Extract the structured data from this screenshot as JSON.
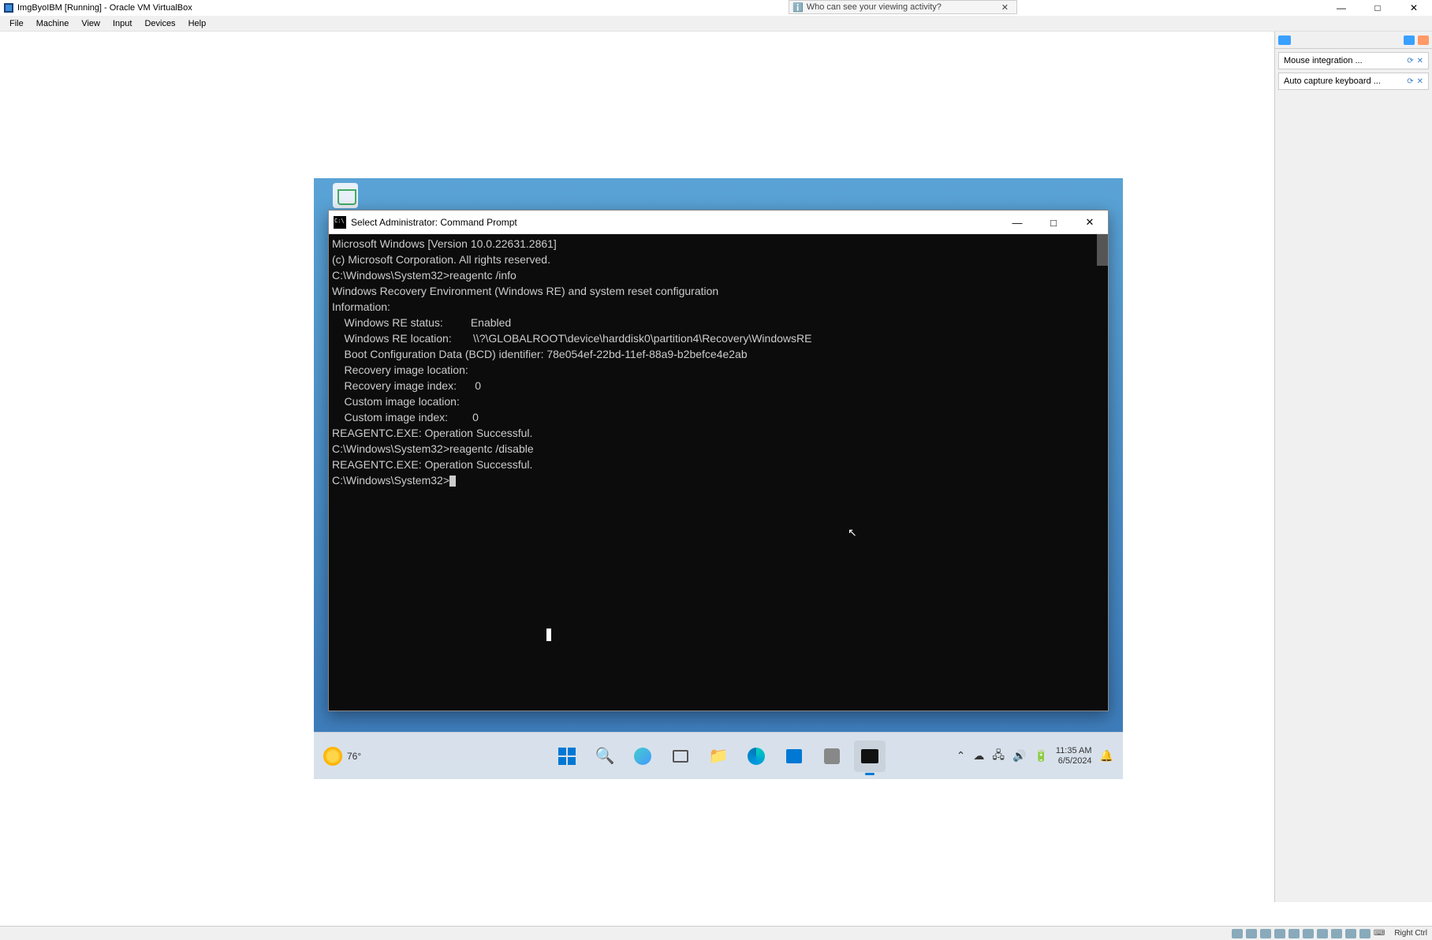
{
  "host_window": {
    "title": "ImgByoIBM [Running] - Oracle VM VirtualBox",
    "menu": [
      "File",
      "Machine",
      "View",
      "Input",
      "Devices",
      "Help"
    ],
    "min": "—",
    "max": "□",
    "close": "✕",
    "notify": {
      "text": "Who can see your viewing activity?",
      "close": "✕"
    }
  },
  "sidebar": {
    "items": [
      {
        "label": "Mouse integration ..."
      },
      {
        "label": "Auto capture keyboard ..."
      }
    ]
  },
  "cmd": {
    "title": "Select Administrator: Command Prompt",
    "min": "—",
    "max": "□",
    "close": "✕",
    "lines": [
      "Microsoft Windows [Version 10.0.22631.2861]",
      "(c) Microsoft Corporation. All rights reserved.",
      "",
      "C:\\Windows\\System32>reagentc /info",
      "Windows Recovery Environment (Windows RE) and system reset configuration",
      "Information:",
      "",
      "    Windows RE status:         Enabled",
      "    Windows RE location:       \\\\?\\GLOBALROOT\\device\\harddisk0\\partition4\\Recovery\\WindowsRE",
      "    Boot Configuration Data (BCD) identifier: 78e054ef-22bd-11ef-88a9-b2befce4e2ab",
      "    Recovery image location:",
      "    Recovery image index:      0",
      "    Custom image location:",
      "    Custom image index:        0",
      "",
      "REAGENTC.EXE: Operation Successful.",
      "",
      "",
      "C:\\Windows\\System32>reagentc /disable",
      "REAGENTC.EXE: Operation Successful.",
      "",
      "",
      "C:\\Windows\\System32>"
    ]
  },
  "taskbar": {
    "weather_temp": "76°",
    "time": "11:35 AM",
    "date": "6/5/2024",
    "tray_up": "⌃"
  },
  "statusbar": {
    "hostkey": "Right Ctrl"
  }
}
